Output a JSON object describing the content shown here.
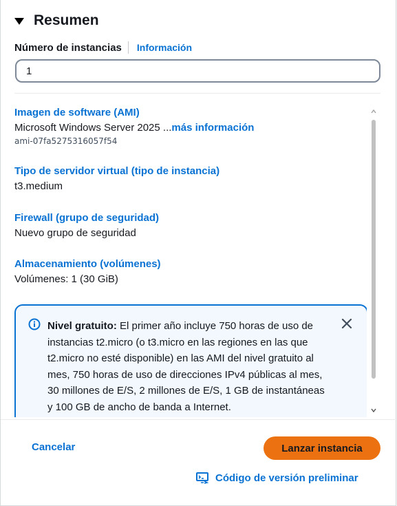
{
  "summary": {
    "title": "Resumen",
    "instance_count_label": "Número de instancias",
    "info_link": "Información",
    "instance_count_value": "1"
  },
  "items": {
    "ami": {
      "title": "Imagen de software (AMI)",
      "value": "Microsoft Windows Server 2025 ...",
      "more_link": "más información",
      "sub": "ami-07fa5275316057f54"
    },
    "instance_type": {
      "title": "Tipo de servidor virtual (tipo de instancia)",
      "value": "t3.medium"
    },
    "firewall": {
      "title": "Firewall (grupo de seguridad)",
      "value": "Nuevo grupo de seguridad"
    },
    "storage": {
      "title": "Almacenamiento (volúmenes)",
      "value": "Volúmenes: 1 (30 GiB)"
    }
  },
  "free_tier": {
    "heading": "Nivel gratuito:",
    "body": " El primer año incluye 750 horas de uso de instancias t2.micro (o t3.micro en las regiones en las que t2.micro no esté disponible) en las AMI del nivel gratuito al mes, 750 horas de uso de direcciones IPv4 públicas al mes, 30 millones de E/S, 2 millones de E/S, 1 GB de instantáneas y 100 GB de ancho de banda a Internet.",
    "icon": "info-icon",
    "close_icon": "close-icon"
  },
  "actions": {
    "cancel": "Cancelar",
    "launch": "Lanzar instancia",
    "preview_code": "Código de versión preliminar",
    "preview_icon": "code-preview-icon"
  },
  "colors": {
    "link": "#0972d3",
    "primary_button": "#ec7211",
    "alert_bg": "#f2f8fd"
  }
}
